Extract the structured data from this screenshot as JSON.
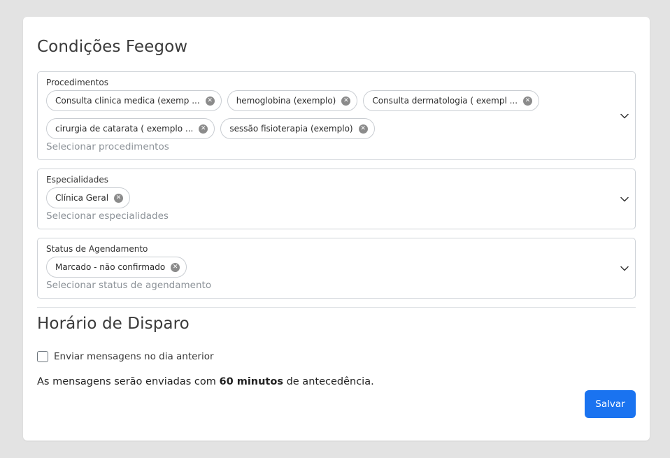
{
  "conditions": {
    "title": "Condições Feegow",
    "procedimentos": {
      "label": "Procedimentos",
      "chips": [
        "Consulta clinica medica (exemp ...",
        "hemoglobina (exemplo)",
        "Consulta dermatologia ( exempl ...",
        "cirurgia de catarata ( exemplo ...",
        "sessão fisioterapia (exemplo)"
      ],
      "placeholder": "Selecionar procedimentos"
    },
    "especialidades": {
      "label": "Especialidades",
      "chips": [
        "Clínica Geral"
      ],
      "placeholder": "Selecionar especialidades"
    },
    "status": {
      "label": "Status de Agendamento",
      "chips": [
        "Marcado - não confirmado"
      ],
      "placeholder": "Selecionar status de agendamento"
    }
  },
  "dispatch": {
    "title": "Horário de Disparo",
    "checkbox_label": "Enviar mensagens no dia anterior",
    "checkbox_checked": false,
    "info_prefix": "As mensagens serão enviadas com",
    "info_bold": "60 minutos",
    "info_suffix": "de antecedência."
  },
  "save_label": "Salvar",
  "colors": {
    "primary": "#1a73f0",
    "chip_remove": "#8b8b8b",
    "placeholder": "#8d9399"
  },
  "icons": {
    "chip_remove": "close-circle-icon",
    "dropdown": "chevron-down-icon"
  }
}
